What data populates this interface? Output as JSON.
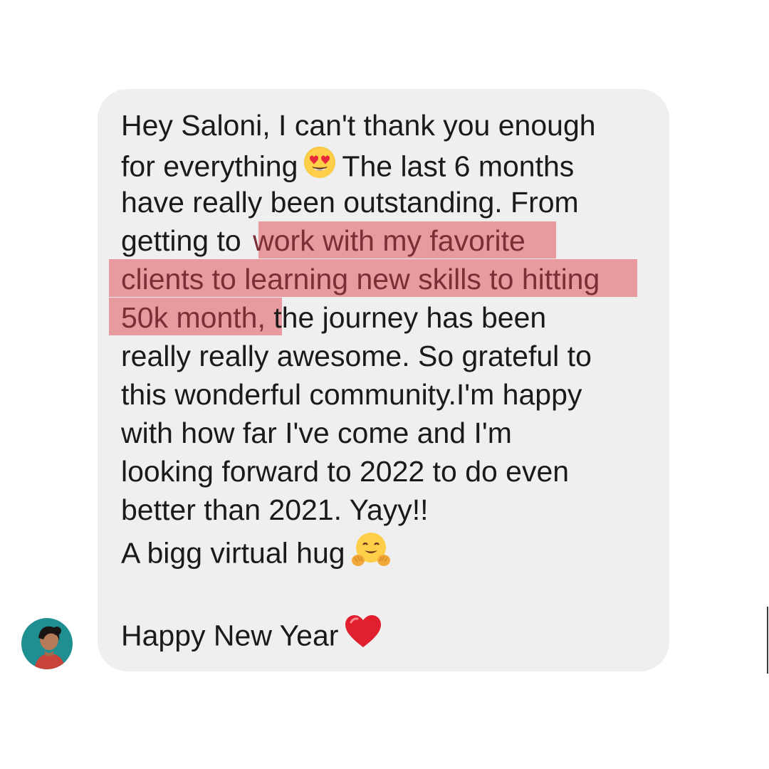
{
  "conversation": {
    "message": {
      "lines": [
        "Hey Saloni, I can't thank you enough",
        "for everything",
        "The last 6 months",
        "have really been outstanding. From",
        "getting to",
        "work with my favorite",
        "clients to learning new skills to hitting",
        "50k month,",
        "the journey has been",
        "really really awesome. So grateful to",
        "this wonderful community.I'm happy",
        "with how far I've come and I'm",
        "looking forward to 2022 to do even",
        "better than 2021. Yayy!!",
        "A bigg virtual hug",
        "Happy New Year"
      ],
      "emojis": {
        "heart_eyes": "smiling-face-with-heart-eyes-icon",
        "hug": "hugging-face-icon",
        "heart": "red-heart-icon"
      },
      "highlight_color": "#e89a9f",
      "bubble_color": "#efefef"
    },
    "sender": {
      "avatar_bg": "#1f8f92"
    }
  }
}
